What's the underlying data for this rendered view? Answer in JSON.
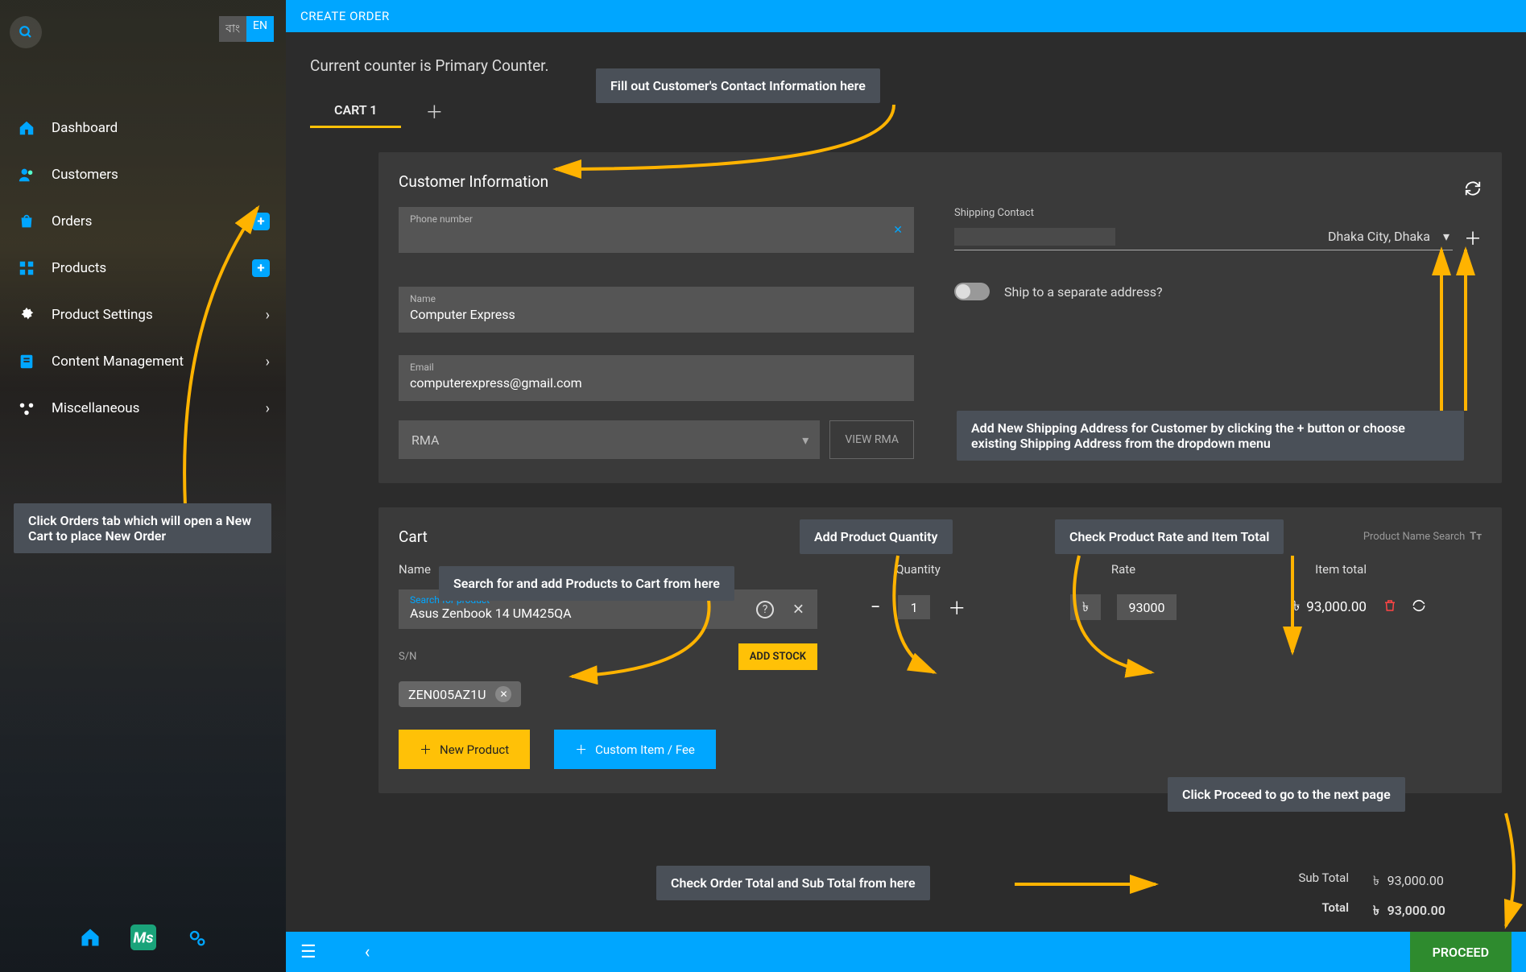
{
  "lang": {
    "bn": "বাং",
    "en": "EN"
  },
  "sidebar": [
    {
      "label": "Dashboard",
      "icon": "home"
    },
    {
      "label": "Customers",
      "icon": "users"
    },
    {
      "label": "Orders",
      "icon": "bag",
      "badge": "+"
    },
    {
      "label": "Products",
      "icon": "boxes",
      "badge": "+"
    },
    {
      "label": "Product Settings",
      "icon": "gear",
      "chev": true
    },
    {
      "label": "Content Management",
      "icon": "doc",
      "chev": true
    },
    {
      "label": "Miscellaneous",
      "icon": "misc",
      "chev": true
    }
  ],
  "topbar": {
    "title": "CREATE ORDER"
  },
  "counter_line": "Current counter is Primary Counter.",
  "tabs": [
    {
      "label": "CART 1",
      "active": true
    }
  ],
  "customer": {
    "title": "Customer Information",
    "phone_label": "Phone number",
    "phone_value": "",
    "name_label": "Name",
    "name_value": "Computer Express",
    "email_label": "Email",
    "email_value": "computerexpress@gmail.com",
    "rma_placeholder": "RMA",
    "view_rma": "VIEW RMA",
    "ship_label": "Shipping Contact",
    "ship_value": "Dhaka City, Dhaka",
    "ship_toggle_label": "Ship to a separate address?"
  },
  "cart": {
    "title": "Cart",
    "search_mode": "Product Name Search",
    "cols": {
      "name": "Name",
      "qty": "Quantity",
      "rate": "Rate",
      "total": "Item total"
    },
    "product_search_label": "Search for product",
    "product_name": "Asus Zenbook 14 UM425QA",
    "qty": "1",
    "rate": "93000",
    "currency": "৳",
    "item_total": "93,000.00",
    "sn_label": "S/N",
    "sn_value": "ZEN005AZ1U",
    "add_stock": "ADD STOCK",
    "new_product": "New Product",
    "custom_item": "Custom Item / Fee"
  },
  "totals": {
    "subtotal_label": "Sub Total",
    "subtotal": "93,000.00",
    "total_label": "Total",
    "total": "93,000.00"
  },
  "proceed": "PROCEED",
  "callouts": {
    "c1": "Fill out Customer's Contact Information here",
    "c2": "Click Orders tab which will open a New Cart to place New Order",
    "c3": "Add New Shipping Address for Customer by clicking the + button or choose existing Shipping Address from the dropdown menu",
    "c4": "Search for and add Products to Cart from here",
    "c5": "Add Product Quantity",
    "c6": "Check Product Rate and Item Total",
    "c7": "Check Order Total and Sub Total from here",
    "c8": "Click Proceed to go to the next page"
  }
}
